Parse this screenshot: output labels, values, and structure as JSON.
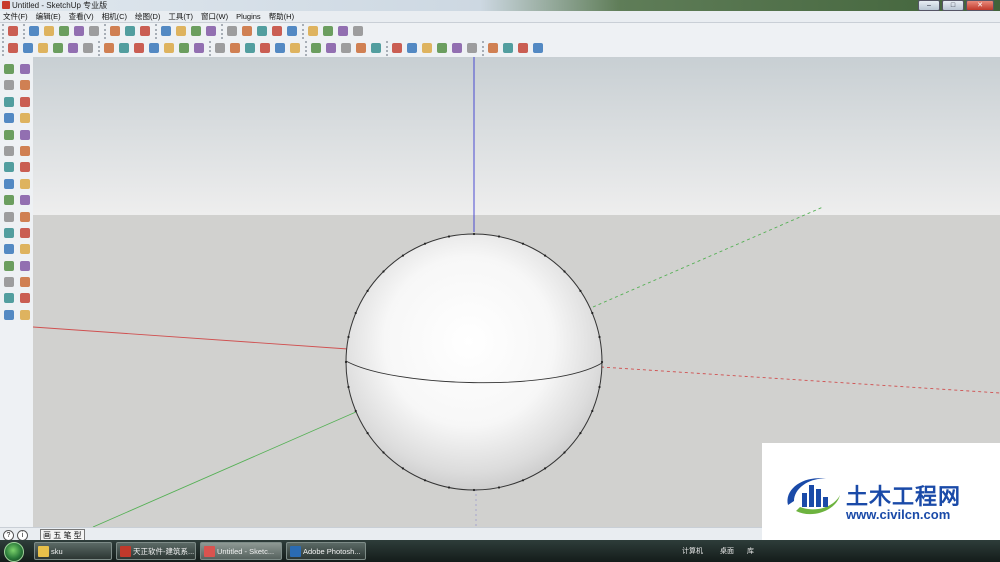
{
  "window": {
    "title": "Untitled - SketchUp 专业版",
    "controls": {
      "minimize": "–",
      "maximize": "□",
      "close": "✕"
    }
  },
  "menu": [
    "文件(F)",
    "编辑(E)",
    "查看(V)",
    "相机(C)",
    "绘图(D)",
    "工具(T)",
    "窗口(W)",
    "Plugins",
    "帮助(H)"
  ],
  "toolbars": {
    "top_row": [
      "select-tool-icon",
      "line-tool-icon",
      "rectangle-tool-icon",
      "circle-tool-icon",
      "arc-tool-icon",
      "make-component-icon",
      "eraser-tool-icon",
      "tape-measure-icon",
      "paint-bucket-icon",
      "push-pull-icon",
      "move-tool-icon",
      "rotate-tool-icon",
      "follow-me-icon",
      "orbit-tool-icon",
      "pan-tool-icon",
      "zoom-tool-icon",
      "zoom-extents-icon",
      "get-models-icon",
      "share-model-icon",
      "share-component-icon",
      "3d-warehouse-icon",
      "extension-warehouse-icon"
    ],
    "second_row": [
      "axes-tool-icon",
      "dimension-icon",
      "protractor-icon",
      "text-tool-icon",
      "3d-text-icon",
      "section-plane-icon",
      "iso-view-icon",
      "top-view-icon",
      "front-view-icon",
      "right-view-icon",
      "back-view-icon",
      "left-view-icon",
      "xray-icon",
      "wireframe-icon",
      "hidden-line-icon",
      "shaded-icon",
      "shaded-texture-icon",
      "monochrome-icon",
      "sandbox-contours-icon",
      "sandbox-scratch-icon",
      "smoove-icon",
      "stamp-icon",
      "drape-icon",
      "add-detail-icon",
      "flip-edge-icon",
      "walk-tool-icon",
      "look-around-icon",
      "position-camera-icon",
      "intersect-icon",
      "union-icon",
      "subtract-icon",
      "trim-icon",
      "split-icon",
      "su-logo-icon"
    ]
  },
  "left_toolbar": [
    "select-tool-icon",
    "make-component-icon",
    "paint-bucket-icon",
    "eraser-tool-icon",
    "rectangle-tool-icon",
    "line-tool-icon",
    "circle-tool-icon",
    "arc-tool-icon",
    "polygon-tool-icon",
    "freehand-tool-icon",
    "move-tool-icon",
    "push-pull-icon",
    "rotate-tool-icon",
    "follow-me-icon",
    "scale-tool-icon",
    "offset-tool-icon",
    "tape-measure-icon",
    "dimension-icon",
    "protractor-icon",
    "text-tool-icon",
    "axes-tool-icon",
    "3d-text-icon",
    "orbit-tool-icon",
    "pan-tool-icon",
    "zoom-tool-icon",
    "zoom-window-icon",
    "previous-view-icon",
    "zoom-extents-icon",
    "position-camera-icon",
    "look-around-icon",
    "walk-tool-icon",
    "section-plane-icon"
  ],
  "status_bar": {
    "info_icon_1": "?",
    "info_icon_2": "i",
    "message": "画 五 笔 型"
  },
  "taskbar": {
    "buttons": [
      {
        "label": "sku",
        "icon_color": "#e8c04a",
        "active": false
      },
      {
        "label": "天正软件-建筑系...",
        "icon_color": "#c0392b",
        "active": false
      },
      {
        "label": "Untitled - Sketc...",
        "icon_color": "#d9534f",
        "active": true
      },
      {
        "label": "Adobe Photosh...",
        "icon_color": "#2a6bb3",
        "active": false
      }
    ],
    "tray": {
      "computer": "计算机",
      "desktop": "桌面",
      "library": "库"
    }
  },
  "watermark": {
    "title": "土木工程网",
    "url": "www.civilcn.com",
    "colors": {
      "blue": "#1a4aa8",
      "green": "#6db33f"
    }
  },
  "colors": {
    "sky_top": "#c8cfd3",
    "sky_bottom": "#eeeeee",
    "ground": "#d1d1cf",
    "axis_red": "#d05050",
    "axis_green": "#55b055",
    "axis_blue": "#3a3ad0"
  }
}
